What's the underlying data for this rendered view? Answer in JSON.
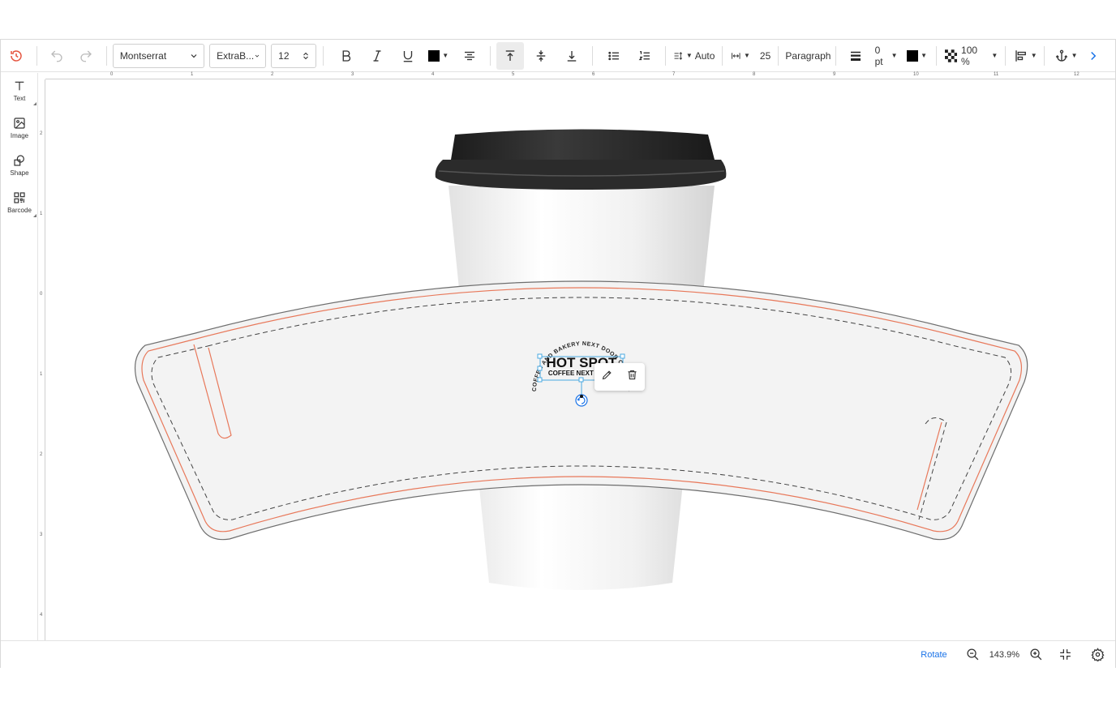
{
  "toolbar": {
    "font_family": "Montserrat",
    "font_weight": "ExtraB...",
    "font_size": "12",
    "line_spacing": "Auto",
    "letter_spacing": "25",
    "paragraph_label": "Paragraph",
    "stroke_width": "0 pt",
    "opacity": "100 %",
    "text_color": "#000000",
    "stroke_color": "#000000"
  },
  "tools": [
    {
      "label": "Text",
      "icon": "text-icon"
    },
    {
      "label": "Image",
      "icon": "image-icon"
    },
    {
      "label": "Shape",
      "icon": "shape-icon"
    },
    {
      "label": "Barcode",
      "icon": "barcode-icon"
    }
  ],
  "ruler": {
    "h_labels": [
      "0",
      "1",
      "2",
      "3",
      "4",
      "5",
      "6",
      "7",
      "8",
      "9",
      "10",
      "11",
      "12"
    ],
    "v_labels": [
      "2",
      "1",
      "0",
      "1",
      "2",
      "3",
      "4"
    ]
  },
  "design": {
    "title": "HOT SPOT",
    "subtitle": "COFFEE NEXT DOOR",
    "arc_text": "COFFEE AND BAKERY NEXT DOOR COFFEE AND BAKERY NEXT DOOR",
    "cut_line_color": "#e8785a"
  },
  "bottom": {
    "rotate_label": "Rotate",
    "zoom": "143.9%"
  }
}
